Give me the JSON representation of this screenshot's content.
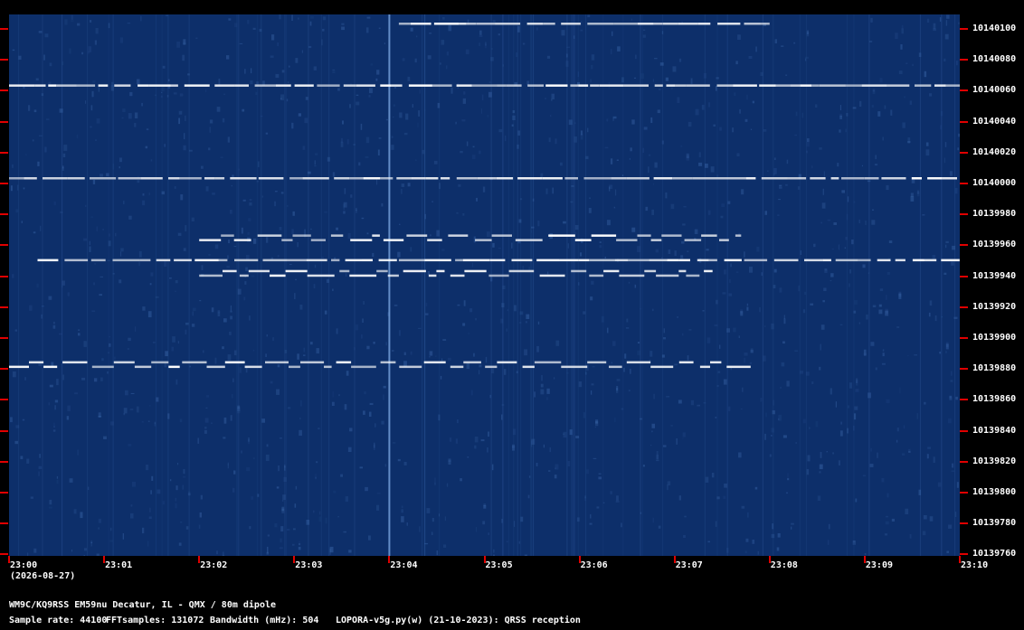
{
  "chart_data": {
    "type": "heatmap",
    "title": "",
    "xlabel": "",
    "ylabel": "",
    "x_tick_labels": [
      "23:00",
      "23:01",
      "23:02",
      "23:03",
      "23:04",
      "23:05",
      "23:06",
      "23:07",
      "23:08",
      "23:09",
      "23:10"
    ],
    "y_tick_labels": [
      "10140100",
      "10140080",
      "10140060",
      "10140040",
      "10140020",
      "10140000",
      "10139980",
      "10139960",
      "10139940",
      "10139920",
      "10139900",
      "10139880",
      "10139860",
      "10139840",
      "10139820",
      "10139800",
      "10139780",
      "10139760"
    ],
    "date_label": "(2026-08-27)",
    "xlim": [
      "23:00",
      "23:10"
    ],
    "ylim": [
      10139760,
      10140100
    ],
    "colormap": {
      "background": "#0d2f6a",
      "signal": "#ffffff",
      "mid": "#6f9bd6"
    },
    "signals": [
      {
        "freq": 10140060,
        "start": "23:00",
        "end": "23:10"
      },
      {
        "freq": 10140000,
        "start": "23:00",
        "end": "23:10"
      },
      {
        "freq": 10139960,
        "start": "23:02",
        "end": "23:07.7"
      },
      {
        "freq": 10139947,
        "start": "23:00.3",
        "end": "23:10"
      },
      {
        "freq": 10139937,
        "start": "23:02",
        "end": "23:07.4"
      },
      {
        "freq": 10139878,
        "start": "23:00",
        "end": "23:07.8"
      },
      {
        "freq": 10140100,
        "start": "23:04.1",
        "end": "23:08"
      }
    ]
  },
  "footer": {
    "station": "WM9C/KQ9RSS EM59nu Decatur, IL - QMX / 80m dipole",
    "sample_rate": "Sample rate: 44100",
    "fft_samples": "FFTsamples: 131072",
    "bandwidth": "Bandwidth (mHz): 504",
    "software": "LOPORA-v5g.py(w) (21-10-2023): QRSS reception"
  }
}
